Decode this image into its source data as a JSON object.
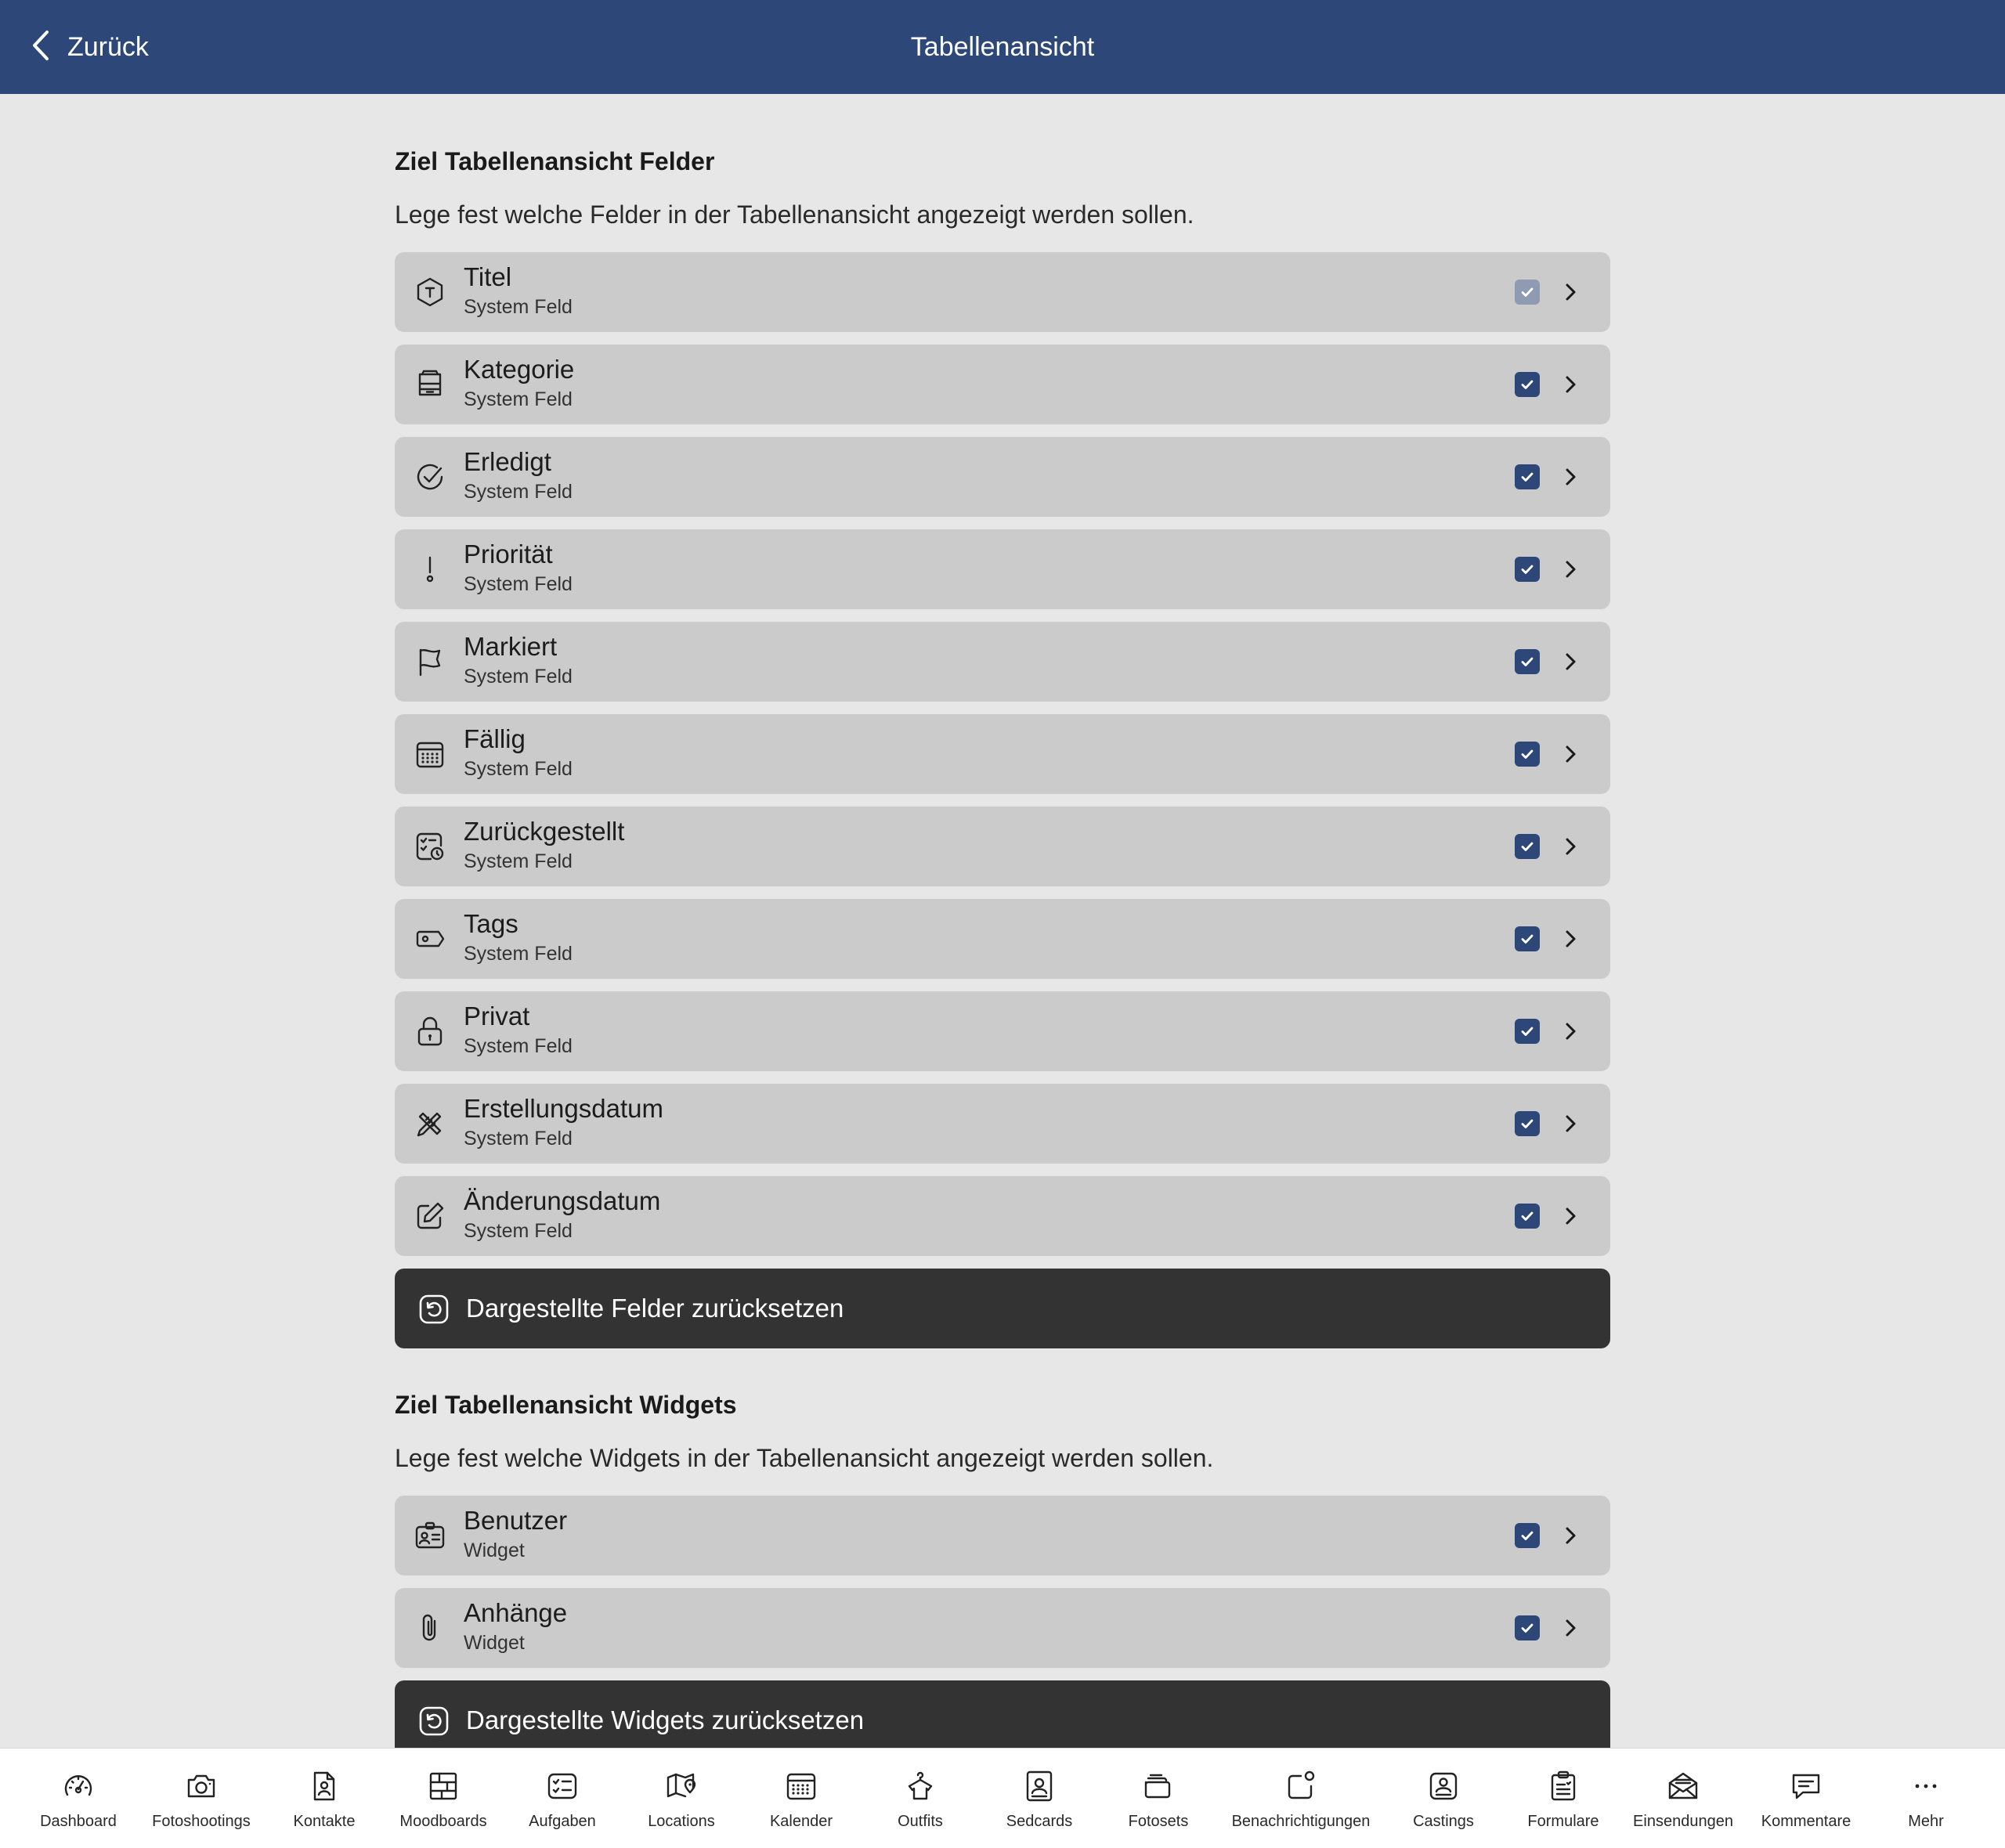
{
  "header": {
    "back_label": "Zurück",
    "title": "Tabellenansicht"
  },
  "colors": {
    "header_bg": "#2c4778",
    "checkbox": "#2c4778",
    "row_bg": "#cbcbcb",
    "button_bg": "#333333",
    "page_bg": "#e7e7e7"
  },
  "fields_section": {
    "title": "Ziel Tabellenansicht Felder",
    "description": "Lege fest welche Felder in der Tabellenansicht angezeigt werden sollen.",
    "items": [
      {
        "name": "Titel",
        "sub": "System Feld",
        "icon": "title-hexagon-icon",
        "checked": true,
        "disabled": true
      },
      {
        "name": "Kategorie",
        "sub": "System Feld",
        "icon": "category-tray-icon",
        "checked": true
      },
      {
        "name": "Erledigt",
        "sub": "System Feld",
        "icon": "check-circle-icon",
        "checked": true
      },
      {
        "name": "Priorität",
        "sub": "System Feld",
        "icon": "exclamation-icon",
        "checked": true
      },
      {
        "name": "Markiert",
        "sub": "System Feld",
        "icon": "flag-icon",
        "checked": true
      },
      {
        "name": "Fällig",
        "sub": "System Feld",
        "icon": "calendar-icon",
        "checked": true
      },
      {
        "name": "Zurückgestellt",
        "sub": "System Feld",
        "icon": "deferred-checklist-clock-icon",
        "checked": true
      },
      {
        "name": "Tags",
        "sub": "System Feld",
        "icon": "tag-icon",
        "checked": true
      },
      {
        "name": "Privat",
        "sub": "System Feld",
        "icon": "lock-icon",
        "checked": true
      },
      {
        "name": "Erstellungsdatum",
        "sub": "System Feld",
        "icon": "pencil-ruler-icon",
        "checked": true
      },
      {
        "name": "Änderungsdatum",
        "sub": "System Feld",
        "icon": "edit-square-icon",
        "checked": true
      }
    ],
    "reset_label": "Dargestellte Felder zurücksetzen"
  },
  "widgets_section": {
    "title": "Ziel Tabellenansicht Widgets",
    "description": "Lege fest welche Widgets in der Tabellenansicht angezeigt werden sollen.",
    "items": [
      {
        "name": "Benutzer",
        "sub": "Widget",
        "icon": "id-badge-icon",
        "checked": true
      },
      {
        "name": "Anhänge",
        "sub": "Widget",
        "icon": "paperclip-icon",
        "checked": true
      }
    ],
    "reset_label": "Dargestellte Widgets zurücksetzen"
  },
  "tabbar": {
    "items": [
      {
        "label": "Dashboard",
        "icon": "speedometer-icon"
      },
      {
        "label": "Fotoshootings",
        "icon": "camera-icon"
      },
      {
        "label": "Kontakte",
        "icon": "contact-file-icon"
      },
      {
        "label": "Moodboards",
        "icon": "moodboard-grid-icon"
      },
      {
        "label": "Aufgaben",
        "icon": "task-list-icon"
      },
      {
        "label": "Locations",
        "icon": "map-pin-icon"
      },
      {
        "label": "Kalender",
        "icon": "calendar-icon"
      },
      {
        "label": "Outfits",
        "icon": "hanger-shirt-icon"
      },
      {
        "label": "Sedcards",
        "icon": "sedcard-portrait-icon"
      },
      {
        "label": "Fotosets",
        "icon": "photo-stack-icon"
      },
      {
        "label": "Benachrichtigungen",
        "icon": "notification-badge-icon"
      },
      {
        "label": "Castings",
        "icon": "casting-card-icon"
      },
      {
        "label": "Formulare",
        "icon": "clipboard-form-icon"
      },
      {
        "label": "Einsendungen",
        "icon": "envelope-open-icon"
      },
      {
        "label": "Kommentare",
        "icon": "comment-bubble-icon"
      },
      {
        "label": "Mehr",
        "icon": "more-dots-icon"
      }
    ]
  }
}
